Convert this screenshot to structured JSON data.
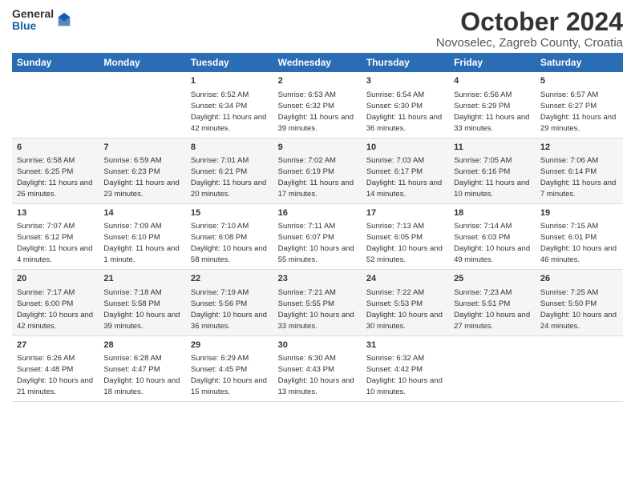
{
  "header": {
    "logo_general": "General",
    "logo_blue": "Blue",
    "month": "October 2024",
    "location": "Novoselec, Zagreb County, Croatia"
  },
  "weekdays": [
    "Sunday",
    "Monday",
    "Tuesday",
    "Wednesday",
    "Thursday",
    "Friday",
    "Saturday"
  ],
  "weeks": [
    [
      {
        "day": "",
        "info": ""
      },
      {
        "day": "",
        "info": ""
      },
      {
        "day": "1",
        "info": "Sunrise: 6:52 AM\nSunset: 6:34 PM\nDaylight: 11 hours and 42 minutes."
      },
      {
        "day": "2",
        "info": "Sunrise: 6:53 AM\nSunset: 6:32 PM\nDaylight: 11 hours and 39 minutes."
      },
      {
        "day": "3",
        "info": "Sunrise: 6:54 AM\nSunset: 6:30 PM\nDaylight: 11 hours and 36 minutes."
      },
      {
        "day": "4",
        "info": "Sunrise: 6:56 AM\nSunset: 6:29 PM\nDaylight: 11 hours and 33 minutes."
      },
      {
        "day": "5",
        "info": "Sunrise: 6:57 AM\nSunset: 6:27 PM\nDaylight: 11 hours and 29 minutes."
      }
    ],
    [
      {
        "day": "6",
        "info": "Sunrise: 6:58 AM\nSunset: 6:25 PM\nDaylight: 11 hours and 26 minutes."
      },
      {
        "day": "7",
        "info": "Sunrise: 6:59 AM\nSunset: 6:23 PM\nDaylight: 11 hours and 23 minutes."
      },
      {
        "day": "8",
        "info": "Sunrise: 7:01 AM\nSunset: 6:21 PM\nDaylight: 11 hours and 20 minutes."
      },
      {
        "day": "9",
        "info": "Sunrise: 7:02 AM\nSunset: 6:19 PM\nDaylight: 11 hours and 17 minutes."
      },
      {
        "day": "10",
        "info": "Sunrise: 7:03 AM\nSunset: 6:17 PM\nDaylight: 11 hours and 14 minutes."
      },
      {
        "day": "11",
        "info": "Sunrise: 7:05 AM\nSunset: 6:16 PM\nDaylight: 11 hours and 10 minutes."
      },
      {
        "day": "12",
        "info": "Sunrise: 7:06 AM\nSunset: 6:14 PM\nDaylight: 11 hours and 7 minutes."
      }
    ],
    [
      {
        "day": "13",
        "info": "Sunrise: 7:07 AM\nSunset: 6:12 PM\nDaylight: 11 hours and 4 minutes."
      },
      {
        "day": "14",
        "info": "Sunrise: 7:09 AM\nSunset: 6:10 PM\nDaylight: 11 hours and 1 minute."
      },
      {
        "day": "15",
        "info": "Sunrise: 7:10 AM\nSunset: 6:08 PM\nDaylight: 10 hours and 58 minutes."
      },
      {
        "day": "16",
        "info": "Sunrise: 7:11 AM\nSunset: 6:07 PM\nDaylight: 10 hours and 55 minutes."
      },
      {
        "day": "17",
        "info": "Sunrise: 7:13 AM\nSunset: 6:05 PM\nDaylight: 10 hours and 52 minutes."
      },
      {
        "day": "18",
        "info": "Sunrise: 7:14 AM\nSunset: 6:03 PM\nDaylight: 10 hours and 49 minutes."
      },
      {
        "day": "19",
        "info": "Sunrise: 7:15 AM\nSunset: 6:01 PM\nDaylight: 10 hours and 46 minutes."
      }
    ],
    [
      {
        "day": "20",
        "info": "Sunrise: 7:17 AM\nSunset: 6:00 PM\nDaylight: 10 hours and 42 minutes."
      },
      {
        "day": "21",
        "info": "Sunrise: 7:18 AM\nSunset: 5:58 PM\nDaylight: 10 hours and 39 minutes."
      },
      {
        "day": "22",
        "info": "Sunrise: 7:19 AM\nSunset: 5:56 PM\nDaylight: 10 hours and 36 minutes."
      },
      {
        "day": "23",
        "info": "Sunrise: 7:21 AM\nSunset: 5:55 PM\nDaylight: 10 hours and 33 minutes."
      },
      {
        "day": "24",
        "info": "Sunrise: 7:22 AM\nSunset: 5:53 PM\nDaylight: 10 hours and 30 minutes."
      },
      {
        "day": "25",
        "info": "Sunrise: 7:23 AM\nSunset: 5:51 PM\nDaylight: 10 hours and 27 minutes."
      },
      {
        "day": "26",
        "info": "Sunrise: 7:25 AM\nSunset: 5:50 PM\nDaylight: 10 hours and 24 minutes."
      }
    ],
    [
      {
        "day": "27",
        "info": "Sunrise: 6:26 AM\nSunset: 4:48 PM\nDaylight: 10 hours and 21 minutes."
      },
      {
        "day": "28",
        "info": "Sunrise: 6:28 AM\nSunset: 4:47 PM\nDaylight: 10 hours and 18 minutes."
      },
      {
        "day": "29",
        "info": "Sunrise: 6:29 AM\nSunset: 4:45 PM\nDaylight: 10 hours and 15 minutes."
      },
      {
        "day": "30",
        "info": "Sunrise: 6:30 AM\nSunset: 4:43 PM\nDaylight: 10 hours and 13 minutes."
      },
      {
        "day": "31",
        "info": "Sunrise: 6:32 AM\nSunset: 4:42 PM\nDaylight: 10 hours and 10 minutes."
      },
      {
        "day": "",
        "info": ""
      },
      {
        "day": "",
        "info": ""
      }
    ]
  ]
}
